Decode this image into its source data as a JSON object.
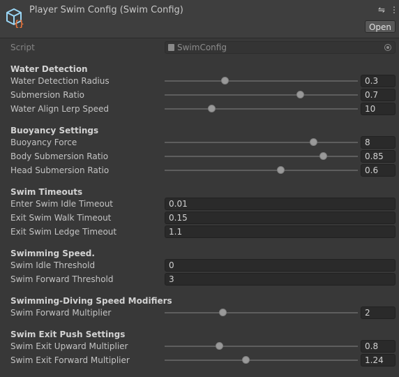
{
  "header": {
    "title": "Player Swim Config (Swim Config)",
    "icon": "scriptable-object-icon",
    "open_label": "Open"
  },
  "script_field": {
    "label": "Script",
    "value": "SwimConfig"
  },
  "colors": {
    "background": "#383838",
    "header": "#3e3e3e",
    "field": "#2a2a2a",
    "icon_accent": "#e8743b",
    "icon_blue": "#9ad6f5"
  },
  "sections": [
    {
      "title": "Water Detection",
      "fields": [
        {
          "label": "Water Detection Radius",
          "type": "slider",
          "value": "0.3",
          "fill": 0.31
        },
        {
          "label": "Submersion Ratio",
          "type": "slider",
          "value": "0.7",
          "fill": 0.7
        },
        {
          "label": "Water Align Lerp Speed",
          "type": "slider",
          "value": "10",
          "fill": 0.24
        }
      ]
    },
    {
      "title": "Buoyancy Settings",
      "fields": [
        {
          "label": "Buoyancy Force",
          "type": "slider",
          "value": "8",
          "fill": 0.77
        },
        {
          "label": "Body Submersion Ratio",
          "type": "slider",
          "value": "0.85",
          "fill": 0.82
        },
        {
          "label": "Head Submersion Ratio",
          "type": "slider",
          "value": "0.6",
          "fill": 0.6
        }
      ]
    },
    {
      "title": "Swim Timeouts",
      "fields": [
        {
          "label": "Enter Swim Idle Timeout",
          "type": "float",
          "value": "0.01"
        },
        {
          "label": "Exit Swim Walk Timeout",
          "type": "float",
          "value": "0.15"
        },
        {
          "label": "Exit Swim Ledge Timeout",
          "type": "float",
          "value": "1.1"
        }
      ]
    },
    {
      "title": "Swimming Speed.",
      "fields": [
        {
          "label": "Swim Idle Threshold",
          "type": "float",
          "value": "0"
        },
        {
          "label": "Swim Forward Threshold",
          "type": "float",
          "value": "3"
        }
      ]
    },
    {
      "title": "Swimming-Diving Speed Modifiers",
      "fields": [
        {
          "label": "Swim Forward Multiplier",
          "type": "slider",
          "value": "2",
          "fill": 0.3
        }
      ]
    },
    {
      "title": "Swim Exit Push Settings",
      "fields": [
        {
          "label": "Swim Exit Upward Multiplier",
          "type": "slider",
          "value": "0.8",
          "fill": 0.28
        },
        {
          "label": "Swim Exit Forward Multiplier",
          "type": "slider",
          "value": "1.24",
          "fill": 0.42
        }
      ]
    }
  ]
}
